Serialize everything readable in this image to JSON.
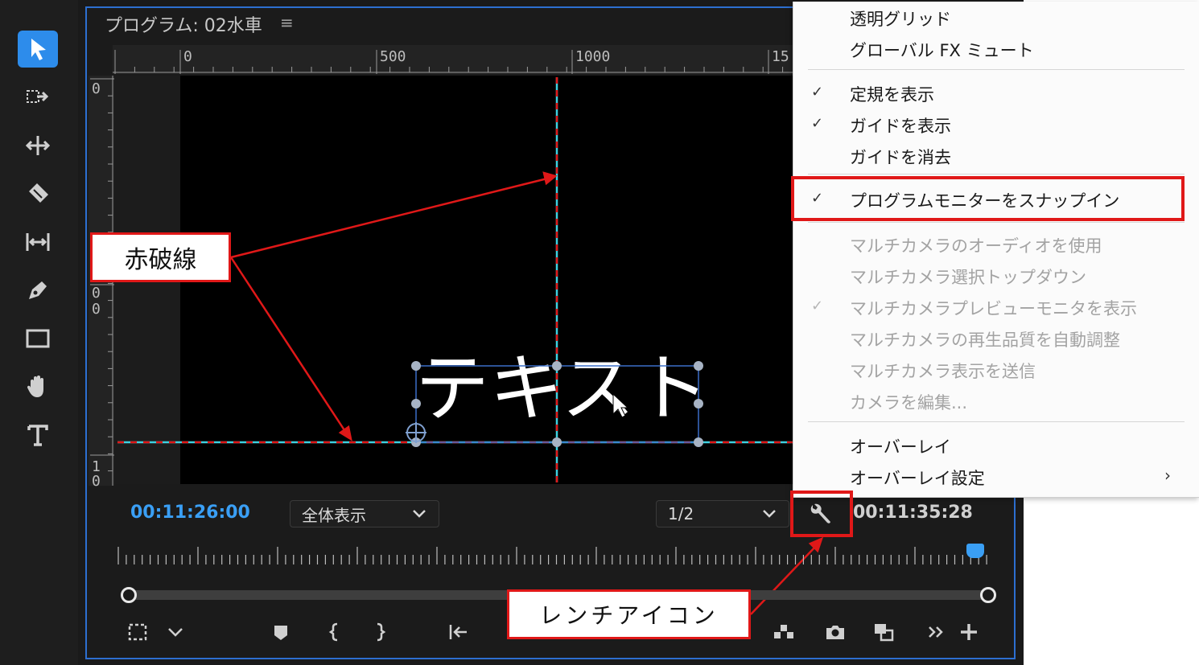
{
  "panel": {
    "title": "プログラム: 02水車",
    "menu_icon": "≡",
    "h_ruler": [
      "0",
      "500",
      "1000",
      "15"
    ],
    "v_ruler_top": "0",
    "v_ruler_mid": [
      "0",
      "0"
    ],
    "v_ruler_bottom": [
      "1",
      "0"
    ]
  },
  "overlay_text": "テキスト",
  "controls": {
    "timecode_current": "00:11:26:00",
    "zoom_value": "全体表示",
    "resolution_value": "1/2",
    "timecode_duration": "00:11:35:28",
    "settings_icon": "wrench-icon"
  },
  "menu": {
    "items": [
      {
        "label": "透明グリッド",
        "checked": false,
        "enabled": true
      },
      {
        "label": "グローバル FX ミュート",
        "checked": false,
        "enabled": true
      },
      {
        "label": "定規を表示",
        "checked": true,
        "enabled": true
      },
      {
        "label": "ガイドを表示",
        "checked": true,
        "enabled": true
      },
      {
        "label": "ガイドを消去",
        "checked": false,
        "enabled": true
      },
      {
        "label": "プログラムモニターをスナップイン",
        "checked": true,
        "enabled": true
      },
      {
        "label": "マルチカメラのオーディオを使用",
        "checked": false,
        "enabled": false
      },
      {
        "label": "マルチカメラ選択トップダウン",
        "checked": false,
        "enabled": false
      },
      {
        "label": "マルチカメラプレビューモニタを表示",
        "checked": true,
        "enabled": false
      },
      {
        "label": "マルチカメラの再生品質を自動調整",
        "checked": false,
        "enabled": false
      },
      {
        "label": "マルチカメラ表示を送信",
        "checked": false,
        "enabled": false
      },
      {
        "label": "カメラを編集...",
        "checked": false,
        "enabled": false
      },
      {
        "label": "オーバーレイ",
        "checked": false,
        "enabled": true
      },
      {
        "label": "オーバーレイ設定",
        "checked": false,
        "enabled": true,
        "submenu": true
      }
    ],
    "check_glyph": "✓",
    "submenu_glyph": "›"
  },
  "annotations": {
    "red_dashed_line_label": "赤破線",
    "wrench_icon_label": "レンチアイコン"
  },
  "colors": {
    "accent": "#2d8ceb",
    "timecode_blue": "#3a9ff5",
    "annotation_red": "#e01818",
    "guide_cyan": "#3fd0e0"
  }
}
